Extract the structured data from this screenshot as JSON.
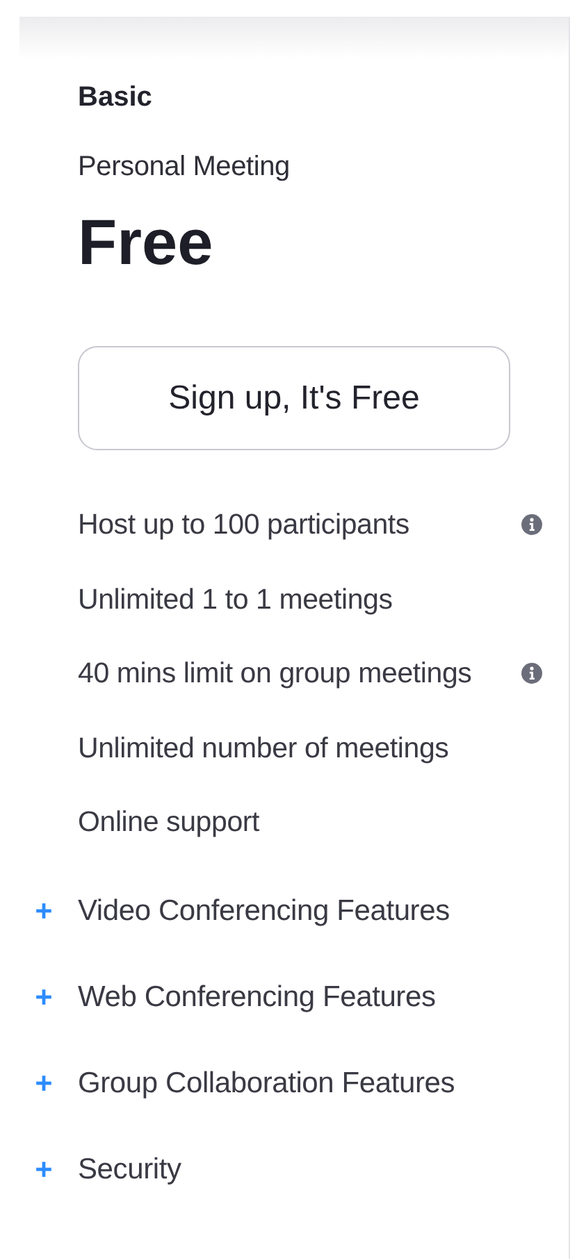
{
  "plan": {
    "name": "Basic",
    "subtitle": "Personal Meeting",
    "price": "Free"
  },
  "signup_button": {
    "label": "Sign up, It's Free"
  },
  "features": [
    {
      "label": "Host up to 100 participants",
      "info": true
    },
    {
      "label": "Unlimited 1 to 1 meetings",
      "info": false
    },
    {
      "label": "40 mins limit on group meetings",
      "info": true
    },
    {
      "label": "Unlimited number of meetings",
      "info": false
    },
    {
      "label": "Online support",
      "info": false
    }
  ],
  "sections": [
    {
      "label": "Video Conferencing Features",
      "expanded": false
    },
    {
      "label": "Web Conferencing Features",
      "expanded": false
    },
    {
      "label": "Group Collaboration Features",
      "expanded": false
    },
    {
      "label": "Security",
      "expanded": false
    }
  ]
}
